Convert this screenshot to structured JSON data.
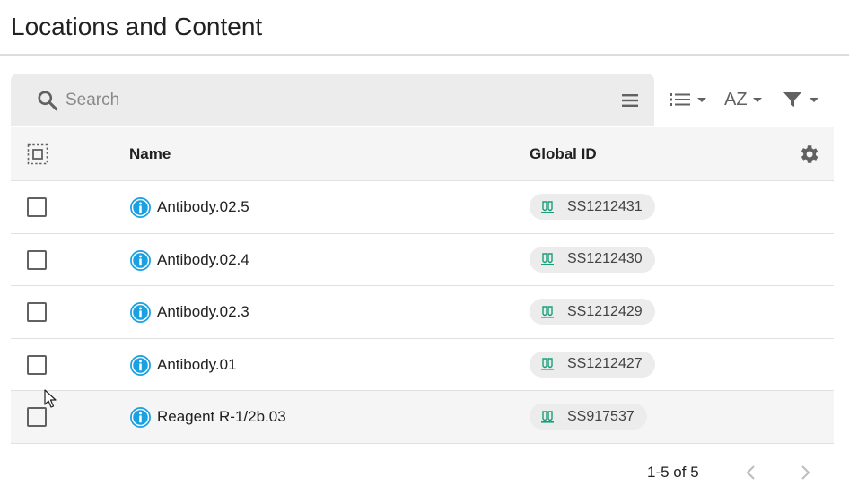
{
  "page": {
    "title": "Locations and Content"
  },
  "search": {
    "placeholder": "Search",
    "value": ""
  },
  "toolbar": {
    "sort_label": "AZ"
  },
  "table": {
    "columns": {
      "name": "Name",
      "global_id": "Global ID"
    },
    "rows": [
      {
        "name": "Antibody.02.5",
        "global_id": "SS1212431"
      },
      {
        "name": "Antibody.02.4",
        "global_id": "SS1212430"
      },
      {
        "name": "Antibody.02.3",
        "global_id": "SS1212429"
      },
      {
        "name": "Antibody.01",
        "global_id": "SS1212427"
      },
      {
        "name": "Reagent R-1/2b.03",
        "global_id": "SS917537"
      }
    ]
  },
  "pagination": {
    "range": "1-5 of 5"
  },
  "colors": {
    "accent_blue": "#1ba1e2",
    "chip_icon_green": "#1a9e7a",
    "header_bg": "#f5f5f5"
  },
  "icons": {
    "search": "search-icon",
    "menu": "menu-icon",
    "list_view": "list-icon",
    "filter": "filter-icon",
    "select_all": "select-all-icon",
    "settings": "gear-icon",
    "info": "info-icon",
    "sample": "sample-tubes-icon",
    "prev": "chevron-left-icon",
    "next": "chevron-right-icon"
  }
}
